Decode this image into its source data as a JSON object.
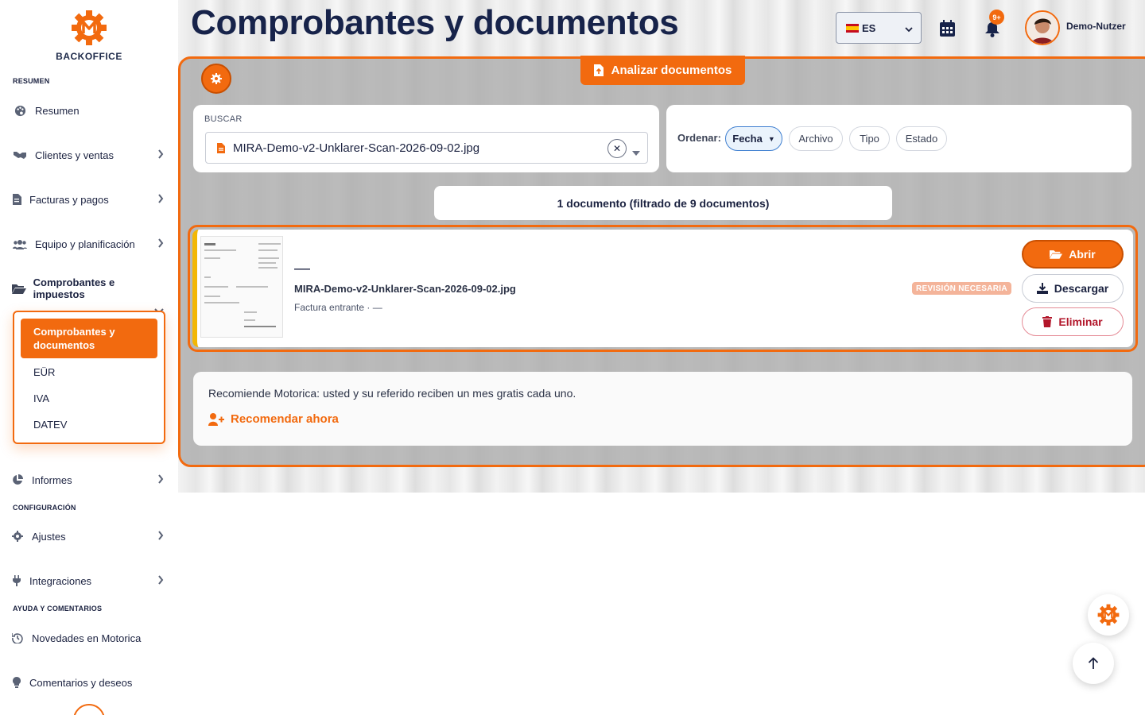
{
  "app": {
    "logo_text": "BACKOFFICE",
    "page_title": "Comprobantes y documentos"
  },
  "header": {
    "language": "ES",
    "notification_count": "9+",
    "user_name": "Demo-Nutzer"
  },
  "sidebar": {
    "sections": {
      "resumen": "RESUMEN",
      "config": "CONFIGURACIÓN",
      "ayuda": "AYUDA Y COMENTARIOS"
    },
    "items": [
      {
        "label": "Resumen",
        "icon": "palette-icon"
      },
      {
        "label": "Clientes y ventas",
        "icon": "handshake-icon"
      },
      {
        "label": "Facturas y pagos",
        "icon": "invoice-icon"
      },
      {
        "label": "Equipo y planificación",
        "icon": "users-icon"
      },
      {
        "label": "Comprobantes e impuestos",
        "icon": "folder-open-icon"
      },
      {
        "label": "Informes",
        "icon": "pie-chart-icon"
      },
      {
        "label": "Ajustes",
        "icon": "gear-icon"
      },
      {
        "label": "Integraciones",
        "icon": "plug-icon"
      },
      {
        "label": "Novedades en Motorica",
        "icon": "history-icon"
      },
      {
        "label": "Comentarios y deseos",
        "icon": "lightbulb-icon"
      }
    ],
    "submenu": {
      "active": "Comprobantes y documentos",
      "items": [
        "EÜR",
        "IVA",
        "DATEV"
      ]
    }
  },
  "toolbar": {
    "analyze_label": "Analizar documentos"
  },
  "search": {
    "label": "BUSCAR",
    "value": "MIRA-Demo-v2-Unklarer-Scan-2026-09-02.jpg"
  },
  "sort": {
    "label": "Ordenar:",
    "options": [
      "Fecha",
      "Archivo",
      "Tipo",
      "Estado"
    ],
    "active": "Fecha"
  },
  "results": {
    "count_text": "1 documento (filtrado de 9 documentos)"
  },
  "document": {
    "title": "—",
    "filename": "MIRA-Demo-v2-Unklarer-Scan-2026-09-02.jpg",
    "subtitle": "Factura entrante · —",
    "status": "REVISIÓN NECESARIA",
    "actions": {
      "open": "Abrir",
      "download": "Descargar",
      "delete": "Eliminar"
    }
  },
  "referral": {
    "text": "Recomiende Motorica: usted y su referido reciben un mes gratis cada uno.",
    "link": "Recomendar ahora"
  },
  "colors": {
    "accent": "#f26a0f",
    "navy": "#17234a",
    "danger": "#b2162a",
    "status_bar": "#f2b705"
  }
}
